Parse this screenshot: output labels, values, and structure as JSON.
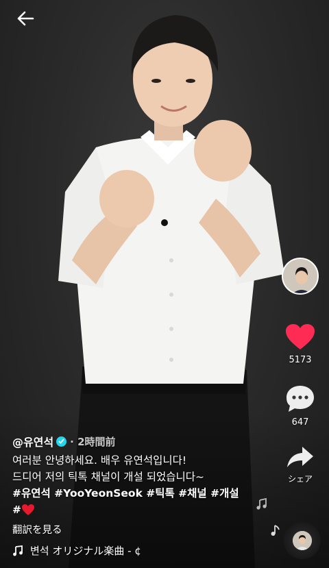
{
  "top": {
    "back_icon": "arrow-left-icon"
  },
  "video": {
    "subject": "person-making-finger-hearts"
  },
  "rail": {
    "avatar_icon": "creator-avatar",
    "like_count": "5173",
    "like_icon": "heart-icon",
    "comment_count": "647",
    "comment_icon": "comment-bubble-icon",
    "share_label": "シェア",
    "share_icon": "share-arrow-icon",
    "like_color": "#fe2c55"
  },
  "post": {
    "username": "@유연석",
    "time_ago": "· 2時間前",
    "caption_line1": "여러분 안녕하세요. 배우 유연석입니다!",
    "caption_line2": "드디어 저의 틱톡 채널이 개설 되었습니다~",
    "hashtags": "#유연석 #YooYeonSeok #틱톡 #채널 #개설",
    "hashtag_prefix": "#",
    "translate_label": "翻訳を見る"
  },
  "music": {
    "label": "변석   オリジナル楽曲 - ¢",
    "icon": "music-note-icon"
  }
}
